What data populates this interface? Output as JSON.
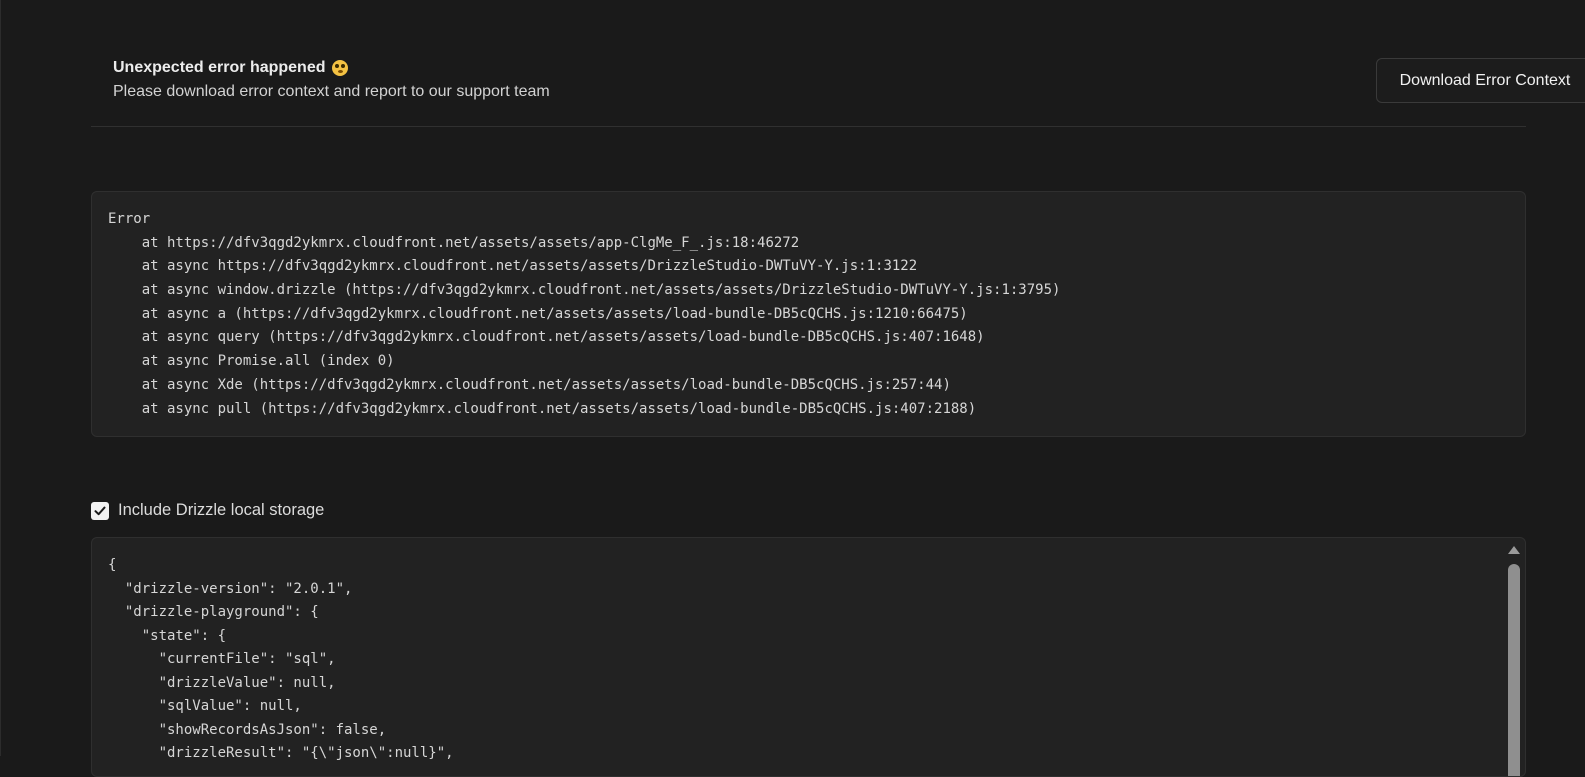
{
  "header": {
    "title": "Unexpected error happened",
    "emoji_icon": "flushed-face-icon",
    "subtitle": "Please download error context and report to our support team",
    "download_label": "Download Error Context"
  },
  "error": {
    "lines": [
      "Error",
      "    at https://dfv3qgd2ykmrx.cloudfront.net/assets/assets/app-ClgMe_F_.js:18:46272",
      "    at async https://dfv3qgd2ykmrx.cloudfront.net/assets/assets/DrizzleStudio-DWTuVY-Y.js:1:3122",
      "    at async window.drizzle (https://dfv3qgd2ykmrx.cloudfront.net/assets/assets/DrizzleStudio-DWTuVY-Y.js:1:3795)",
      "    at async a (https://dfv3qgd2ykmrx.cloudfront.net/assets/assets/load-bundle-DB5cQCHS.js:1210:66475)",
      "    at async query (https://dfv3qgd2ykmrx.cloudfront.net/assets/assets/load-bundle-DB5cQCHS.js:407:1648)",
      "    at async Promise.all (index 0)",
      "    at async Xde (https://dfv3qgd2ykmrx.cloudfront.net/assets/assets/load-bundle-DB5cQCHS.js:257:44)",
      "    at async pull (https://dfv3qgd2ykmrx.cloudfront.net/assets/assets/load-bundle-DB5cQCHS.js:407:2188)"
    ]
  },
  "storage": {
    "checkbox_label": "Include Drizzle local storage",
    "checked": true,
    "json_lines": [
      "{",
      "  \"drizzle-version\": \"2.0.1\",",
      "  \"drizzle-playground\": {",
      "    \"state\": {",
      "      \"currentFile\": \"sql\",",
      "      \"drizzleValue\": null,",
      "      \"sqlValue\": null,",
      "      \"showRecordsAsJson\": false,",
      "      \"drizzleResult\": \"{\\\"json\\\":null}\","
    ]
  },
  "colors": {
    "background": "#1a1a1a",
    "panel": "#222222",
    "border": "#2f2f2f",
    "text": "#e6e6e6",
    "checkbox": "#f2f2f2"
  }
}
